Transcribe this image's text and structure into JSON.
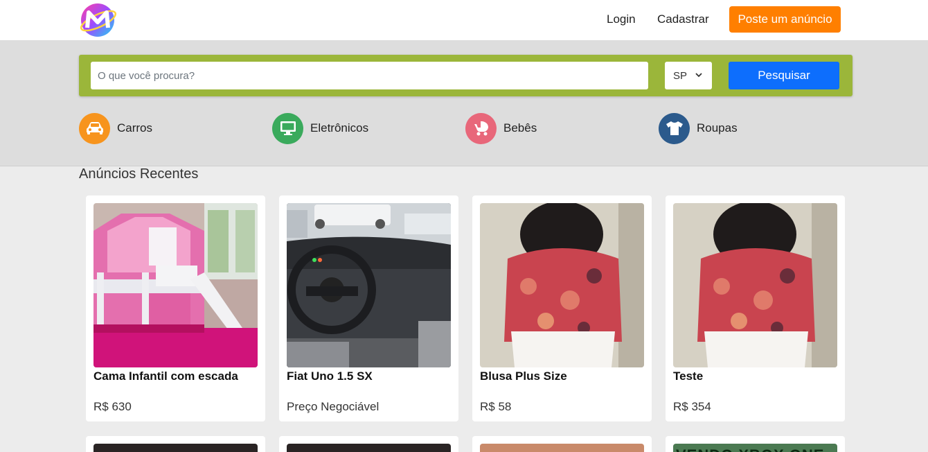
{
  "header": {
    "logo_letter": "M",
    "login": "Login",
    "register": "Cadastrar",
    "post_ad": "Poste um anúncio"
  },
  "search": {
    "placeholder": "O que você procura?",
    "state": "SP",
    "button": "Pesquisar"
  },
  "categories": [
    {
      "label": "Carros",
      "icon": "car-icon",
      "color": "#f7941d"
    },
    {
      "label": "Eletrônicos",
      "icon": "monitor-icon",
      "color": "#3aaa5c"
    },
    {
      "label": "Bebês",
      "icon": "stroller-icon",
      "color": "#e8677a"
    },
    {
      "label": "Roupas",
      "icon": "shirt-icon",
      "color": "#2b5a8c"
    }
  ],
  "recent": {
    "title": "Anúncios Recentes",
    "ads": [
      {
        "title": "Cama Infantil com escada",
        "price": "R$ 630"
      },
      {
        "title": "Fiat Uno 1.5 SX",
        "price": "Preço Negociável"
      },
      {
        "title": "Blusa Plus Size",
        "price": "R$ 58"
      },
      {
        "title": "Teste",
        "price": "R$ 354"
      }
    ],
    "next_row_banner": "VENDO XBOX ONE"
  },
  "colors": {
    "accent_orange": "#ff7f00",
    "search_bar": "#9bb63a",
    "primary_blue": "#0d6efd"
  }
}
